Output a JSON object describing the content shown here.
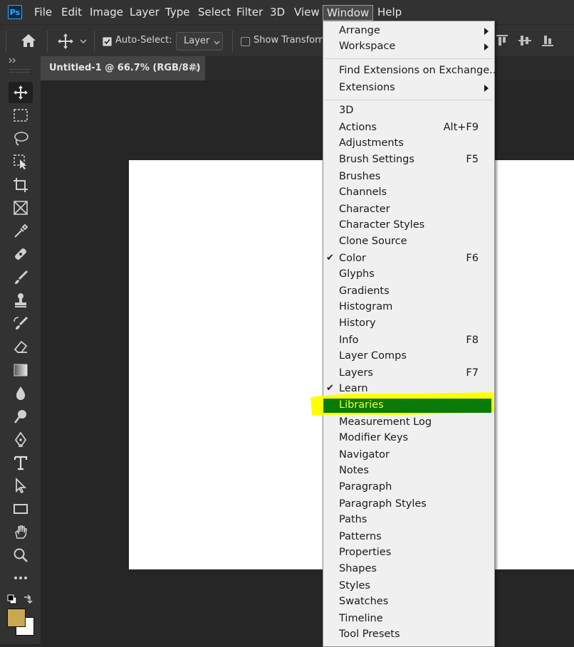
{
  "app": {
    "logo": "Ps"
  },
  "menubar": {
    "items": [
      "File",
      "Edit",
      "Image",
      "Layer",
      "Type",
      "Select",
      "Filter",
      "3D",
      "View",
      "Window",
      "Help"
    ]
  },
  "options": {
    "auto_select_label": "Auto-Select:",
    "auto_select_value": "Layer",
    "show_transform_label": "Show Transform"
  },
  "document_tab": {
    "title": "Untitled-1 @ 66.7% (RGB/8#)",
    "close": "×"
  },
  "colors": {
    "foreground": "#c8a850",
    "background": "#ffffff",
    "highlight_box": "#ffff00",
    "highlight_fill": "#0a7a0a"
  },
  "window_menu": {
    "group1": [
      {
        "label": "Arrange",
        "submenu": true
      },
      {
        "label": "Workspace",
        "submenu": true
      }
    ],
    "group2": [
      {
        "label": "Find Extensions on Exchange..."
      },
      {
        "label": "Extensions",
        "submenu": true
      }
    ],
    "group3": [
      {
        "label": "3D"
      },
      {
        "label": "Actions",
        "shortcut": "Alt+F9"
      },
      {
        "label": "Adjustments"
      },
      {
        "label": "Brush Settings",
        "shortcut": "F5"
      },
      {
        "label": "Brushes"
      },
      {
        "label": "Channels"
      },
      {
        "label": "Character"
      },
      {
        "label": "Character Styles"
      },
      {
        "label": "Clone Source"
      },
      {
        "label": "Color",
        "shortcut": "F6",
        "checked": true
      },
      {
        "label": "Glyphs"
      },
      {
        "label": "Gradients"
      },
      {
        "label": "Histogram"
      },
      {
        "label": "History"
      },
      {
        "label": "Info",
        "shortcut": "F8"
      },
      {
        "label": "Layer Comps"
      },
      {
        "label": "Layers",
        "shortcut": "F7"
      },
      {
        "label": "Learn",
        "checked": true
      },
      {
        "label": "Libraries",
        "highlighted": true
      },
      {
        "label": "Measurement Log"
      },
      {
        "label": "Modifier Keys"
      },
      {
        "label": "Navigator"
      },
      {
        "label": "Notes"
      },
      {
        "label": "Paragraph"
      },
      {
        "label": "Paragraph Styles"
      },
      {
        "label": "Paths"
      },
      {
        "label": "Patterns"
      },
      {
        "label": "Properties"
      },
      {
        "label": "Shapes"
      },
      {
        "label": "Styles"
      },
      {
        "label": "Swatches"
      },
      {
        "label": "Timeline"
      },
      {
        "label": "Tool Presets"
      }
    ]
  },
  "toolbox": {
    "tools": [
      "move-tool",
      "rectangular-marquee-tool",
      "lasso-tool",
      "object-selection-tool",
      "crop-tool",
      "frame-tool",
      "eyedropper-tool",
      "spot-healing-tool",
      "brush-tool",
      "clone-stamp-tool",
      "history-brush-tool",
      "eraser-tool",
      "gradient-tool",
      "blur-tool",
      "dodge-tool",
      "pen-tool",
      "type-tool",
      "path-selection-tool",
      "rectangle-tool",
      "hand-tool",
      "zoom-tool",
      "more-tools"
    ]
  }
}
